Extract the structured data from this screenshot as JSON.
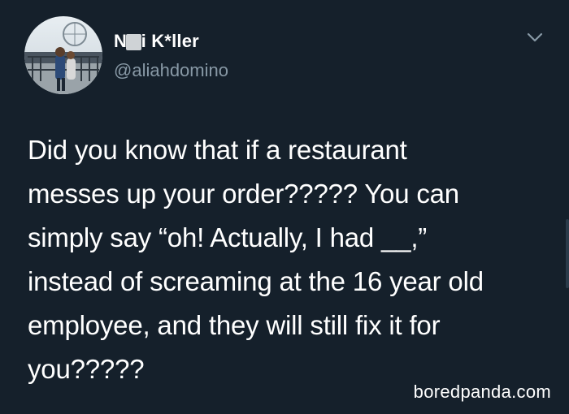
{
  "tweet": {
    "author": {
      "display_name": "N   zi K*ller",
      "handle": "@aliahdomino"
    },
    "text_lines": [
      "Did you know that if a restaurant",
      "messes up your order????? You can",
      "simply say “oh! Actually, I had __,”",
      "instead of screaming at the 16 year old",
      "employee, and they will still fix it for",
      "you?????"
    ],
    "menu_icon": "chevron-down-icon"
  },
  "watermark": {
    "text": "boredpanda.com"
  },
  "colors": {
    "background": "#15202b",
    "text": "#ffffff",
    "secondary_text": "#8899a6"
  }
}
